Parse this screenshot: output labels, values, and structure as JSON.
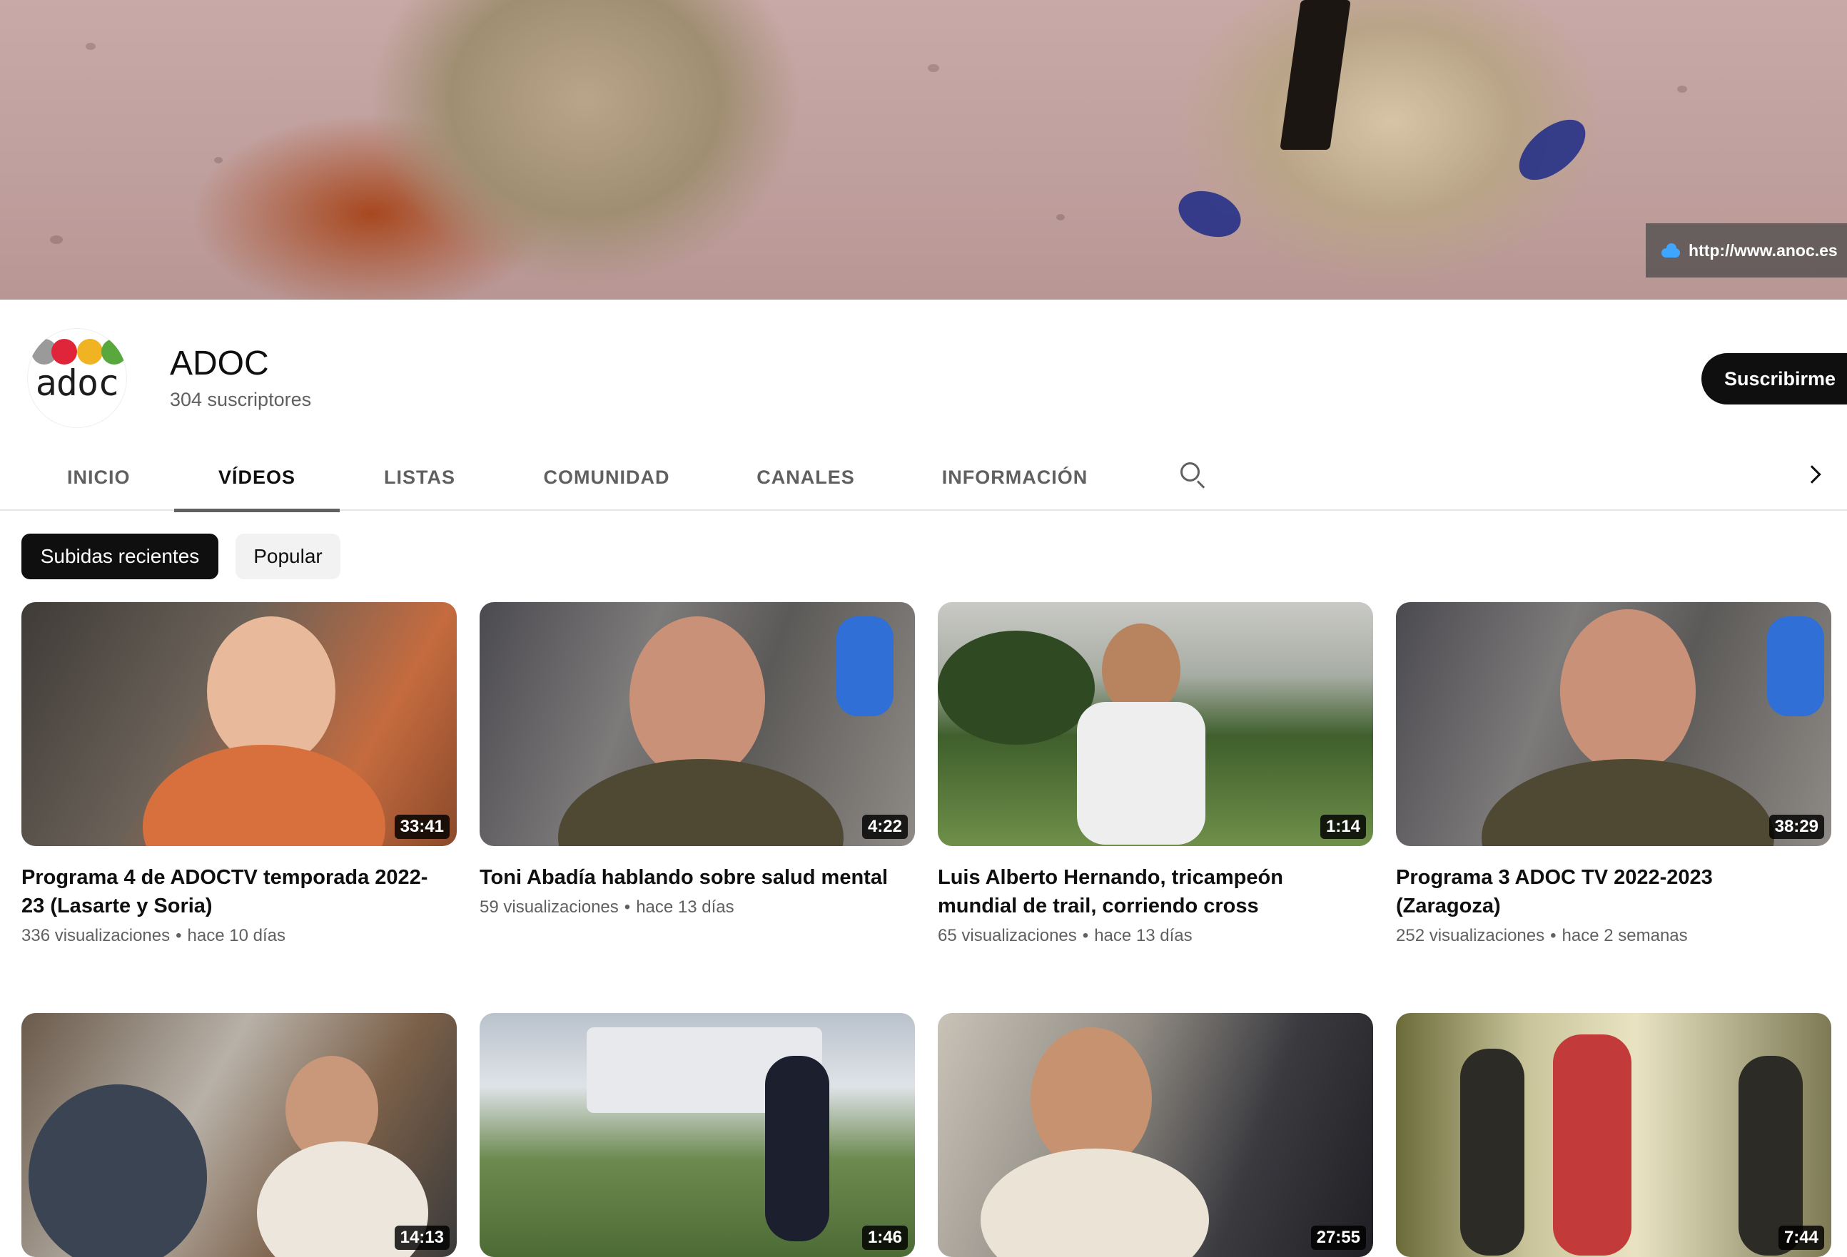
{
  "banner": {
    "link": "http://www.anoc.es"
  },
  "channel": {
    "logo_text": "adoc",
    "logo_colors": [
      "#9a9a9a",
      "#e0243a",
      "#f0b322",
      "#58a83e"
    ],
    "name": "ADOC",
    "subscribers": "304 suscriptores",
    "subscribe_label": "Suscribirme"
  },
  "tabs": [
    {
      "label": "INICIO",
      "active": false
    },
    {
      "label": "VÍDEOS",
      "active": true
    },
    {
      "label": "LISTAS",
      "active": false
    },
    {
      "label": "COMUNIDAD",
      "active": false
    },
    {
      "label": "CANALES",
      "active": false
    },
    {
      "label": "INFORMACIÓN",
      "active": false
    }
  ],
  "chips": [
    {
      "label": "Subidas recientes",
      "selected": true
    },
    {
      "label": "Popular",
      "selected": false
    }
  ],
  "videos": [
    {
      "title": "Programa 4 de ADOCTV temporada 2022-23 (Lasarte y Soria)",
      "views": "336 visualizaciones",
      "age": "hace 10 días",
      "duration": "33:41"
    },
    {
      "title": "Toni Abadía hablando sobre salud mental",
      "views": "59 visualizaciones",
      "age": "hace 13 días",
      "duration": "4:22"
    },
    {
      "title": "Luis Alberto Hernando, tricampeón mundial de trail, corriendo cross",
      "views": "65 visualizaciones",
      "age": "hace 13 días",
      "duration": "1:14"
    },
    {
      "title": "Programa 3 ADOC TV 2022-2023 (Zaragoza)",
      "views": "252 visualizaciones",
      "age": "hace 2 semanas",
      "duration": "38:29"
    },
    {
      "duration": "14:13"
    },
    {
      "duration": "1:46"
    },
    {
      "duration": "27:55"
    },
    {
      "duration": "7:44"
    }
  ],
  "meta_separator": "•",
  "colors": {
    "text_primary": "#0f0f0f",
    "text_secondary": "#606060",
    "chip_selected": "#0f0f0f",
    "chip_plain": "#f2f2f2"
  },
  "icons": [
    "cloud-icon",
    "search-icon",
    "chevron-right-icon"
  ]
}
